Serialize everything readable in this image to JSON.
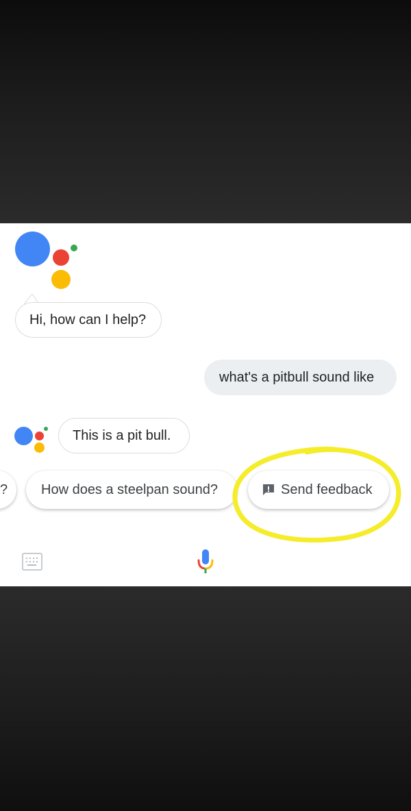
{
  "conversation": {
    "greeting": "Hi, how can I help?",
    "user_query": "what's a pitbull sound like",
    "assistant_answer": "This is a pit bull."
  },
  "suggestions": {
    "partial_chip": "?",
    "chips": [
      {
        "label": "How does a steelpan sound?"
      },
      {
        "label": "Send feedback",
        "icon": "feedback-icon"
      }
    ]
  },
  "input_bar": {
    "keyboard_icon": "keyboard-icon",
    "mic_icon": "mic-icon"
  },
  "colors": {
    "blue": "#4285F4",
    "red": "#EA4335",
    "yellow": "#FBBC05",
    "green": "#34A853",
    "highlight": "#F5EC2A",
    "user_bubble": "#ECEFF1"
  }
}
